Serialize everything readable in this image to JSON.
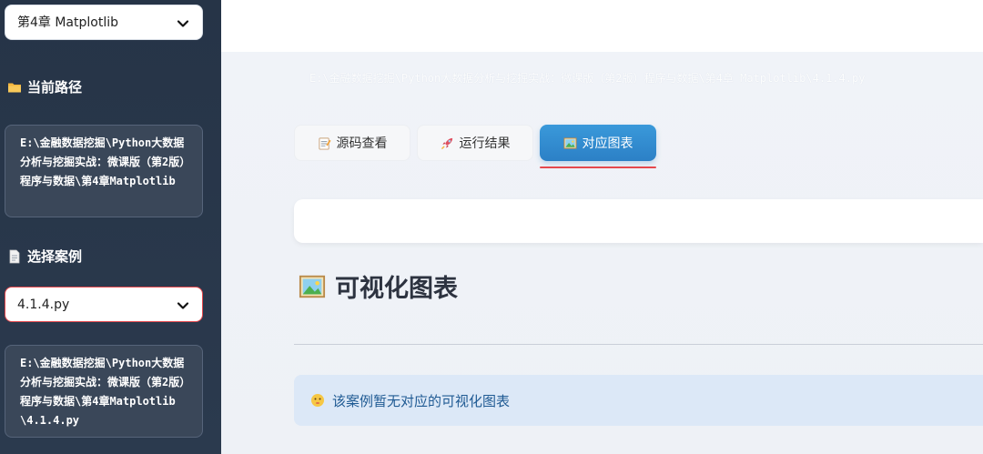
{
  "sidebar": {
    "chapter_select": "第4章 Matplotlib",
    "current_path_title": "当前路径",
    "current_path": "E:\\金融数据挖掘\\Python大数据分析与挖掘实战：微课版（第2版）程序与数据\\第4章Matplotlib",
    "case_title": "选择案例",
    "case_select": "4.1.4.py",
    "case_path": "E:\\金融数据挖掘\\Python大数据分析与挖掘实战：微课版（第2版）程序与数据\\第4章Matplotlib\\4.1.4.py"
  },
  "main": {
    "breadcrumb": "E:\\金融数据挖掘\\Python大数据分析与挖掘实战：微课版（第2版）程序与数据\\第4章 Matplotlib\\4.1.4.py",
    "tabs": [
      {
        "label": "源码查看",
        "icon": "memo-icon"
      },
      {
        "label": "运行结果",
        "icon": "rocket-icon"
      },
      {
        "label": "对应图表",
        "icon": "picture-icon"
      }
    ],
    "active_tab": 2,
    "heading": "可视化图表",
    "info_message": "该案例暂无对应的可视化图表"
  },
  "colors": {
    "sidebar_bg": "#263447",
    "tab_active": "#2c80c6",
    "tab_underline": "#e5484d",
    "info_bg": "#dce8f7",
    "info_text": "#1f5a93"
  }
}
